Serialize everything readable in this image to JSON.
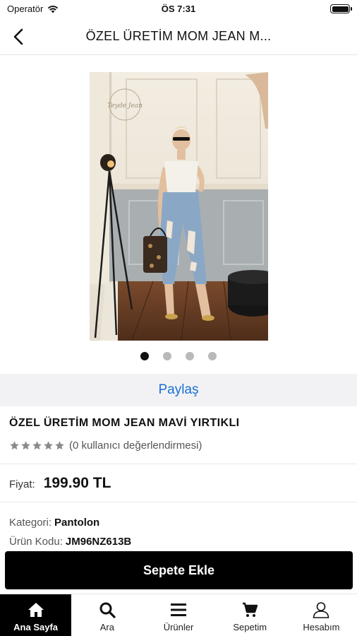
{
  "status_bar": {
    "carrier": "Operatör",
    "time": "ÖS 7:31"
  },
  "nav": {
    "title": "ÖZEL ÜRETİM MOM JEAN M..."
  },
  "gallery": {
    "image_watermark": "Teyde Jean",
    "total_images": 4,
    "active_index": 0
  },
  "share": {
    "label": "Paylaş"
  },
  "product": {
    "title": "ÖZEL ÜRETİM MOM JEAN MAVİ YIRTIKLI",
    "rating_stars": 0,
    "rating_text": "(0 kullanıcı değerlendirmesi)",
    "price_label": "Fiyat:",
    "price_value": "199.90 TL",
    "category_label": "Kategori:",
    "category_value": "Pantolon",
    "code_label": "Ürün Kodu:",
    "code_value": "JM96NZ613B"
  },
  "actions": {
    "add_to_cart": "Sepete Ekle"
  },
  "tabs": [
    {
      "label": "Ana Sayfa",
      "icon": "home-icon",
      "active": true
    },
    {
      "label": "Ara",
      "icon": "search-icon",
      "active": false
    },
    {
      "label": "Ürünler",
      "icon": "menu-icon",
      "active": false
    },
    {
      "label": "Sepetim",
      "icon": "cart-icon",
      "active": false
    },
    {
      "label": "Hesabım",
      "icon": "user-icon",
      "active": false
    }
  ],
  "colors": {
    "accent_link": "#1a6fd6",
    "primary_button": "#000000",
    "star_empty": "#8a8a8a"
  }
}
